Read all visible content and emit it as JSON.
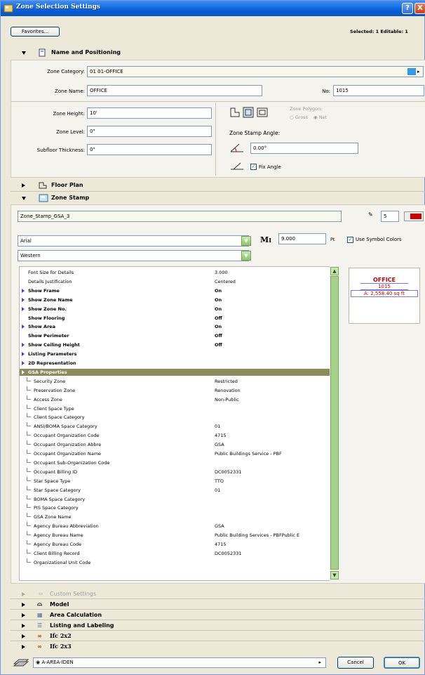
{
  "window": {
    "title": "Zone Selection Settings",
    "help": "?",
    "close": "X"
  },
  "toolbar": {
    "favorites": "Favorites...",
    "selected": "Selected: 1 Editable: 1"
  },
  "name_positioning": {
    "header": "Name and Positioning",
    "category_label": "Zone Category:",
    "category_value": "01  01-OFFICE",
    "category_color": "#3399ee",
    "name_label": "Zone Name:",
    "name_value": "OFFICE",
    "no_label": "No:",
    "no_value": "1015",
    "height_label": "Zone Height:",
    "height_value": "10'",
    "level_label": "Zone Level:",
    "level_value": "0\"",
    "subfloor_label": "Subfloor Thickness:",
    "subfloor_value": "0\"",
    "polygon_label": "Zone Polygon:",
    "gross": "Gross",
    "net": "Net",
    "stamp_angle_label": "Zone Stamp Angle:",
    "stamp_angle_value": "0.00°",
    "fix_angle": "Fix Angle"
  },
  "floor_plan": {
    "header": "Floor Plan"
  },
  "zone_stamp": {
    "header": "Zone Stamp",
    "stamp_name": "Zone_Stamp_GSA_3",
    "pen_value": "5",
    "font": "Arial",
    "font_size": "9.000",
    "size_unit": "Pt",
    "script": "Western",
    "use_symbol_colors": "Use Symbol Colors",
    "params": [
      {
        "k": "Font Size for Details",
        "v": "3.000",
        "style": ""
      },
      {
        "k": "Details Justification",
        "v": "Centered",
        "style": ""
      },
      {
        "k": "Show Frame",
        "v": "On",
        "style": "b arr"
      },
      {
        "k": "Show Zone Name",
        "v": "On",
        "style": "b arr"
      },
      {
        "k": "Show Zone No.",
        "v": "On",
        "style": "b arr"
      },
      {
        "k": "Show Flooring",
        "v": "Off",
        "style": "b"
      },
      {
        "k": "Show Area",
        "v": "On",
        "style": "b arr"
      },
      {
        "k": "Show Perimeter",
        "v": "Off",
        "style": "b"
      },
      {
        "k": "Show Ceiling Height",
        "v": "Off",
        "style": "b arr"
      },
      {
        "k": "Listing Parameters",
        "v": "",
        "style": "b arr"
      },
      {
        "k": "2D Representation",
        "v": "",
        "style": "b arr"
      },
      {
        "k": "GSA Properties",
        "v": "",
        "style": "sel"
      },
      {
        "k": "Security Zone",
        "v": "Restricted",
        "style": "tree"
      },
      {
        "k": "Preservation Zone",
        "v": "Renovation",
        "style": "tree"
      },
      {
        "k": "Access Zone",
        "v": "Non-Public",
        "style": "tree"
      },
      {
        "k": "Client Space Type",
        "v": "",
        "style": "tree"
      },
      {
        "k": "Client Space Category",
        "v": "",
        "style": "tree"
      },
      {
        "k": "ANSI/BOMA Space Category",
        "v": "01",
        "style": "tree"
      },
      {
        "k": "Occupant Organization Code",
        "v": "4715",
        "style": "tree"
      },
      {
        "k": "Occupant Organization Abbre",
        "v": "GSA",
        "style": "tree"
      },
      {
        "k": "Occupant Organization Name",
        "v": "Public Buildings Service - PBF",
        "style": "tree"
      },
      {
        "k": "Occupant Sub-Organization Code",
        "v": "",
        "style": "tree"
      },
      {
        "k": "Occupant Billing ID",
        "v": "DC0052331",
        "style": "tree"
      },
      {
        "k": "Star Space Type",
        "v": "TTO",
        "style": "tree"
      },
      {
        "k": "Star Space Category",
        "v": "01",
        "style": "tree"
      },
      {
        "k": "BOMA Space Category",
        "v": "",
        "style": "tree"
      },
      {
        "k": "PIS Space Category",
        "v": "",
        "style": "tree"
      },
      {
        "k": "GSA Zone Name",
        "v": "",
        "style": "tree"
      },
      {
        "k": "Agency Bureau Abbreviation",
        "v": "GSA",
        "style": "tree"
      },
      {
        "k": "Agency Bureau Name",
        "v": "Public Building Services - PBFPublic E",
        "style": "tree"
      },
      {
        "k": "Agency Bureau Code",
        "v": "4715",
        "style": "tree"
      },
      {
        "k": "Client Billing Record",
        "v": "DC0052331",
        "style": "tree"
      },
      {
        "k": "Organizational Unit Code",
        "v": "",
        "style": "tree"
      }
    ],
    "preview_name": "OFFICE",
    "preview_no": "1015",
    "preview_area": "A: 2,558.40 sq ft"
  },
  "collapsed_sections": [
    "Custom Settings",
    "Model",
    "Area Calculation",
    "Listing and Labeling",
    "Ifc 2x2",
    "Ifc 2x3"
  ],
  "footer": {
    "layer": "A-AREA-IDEN",
    "cancel": "Cancel",
    "ok": "OK"
  }
}
